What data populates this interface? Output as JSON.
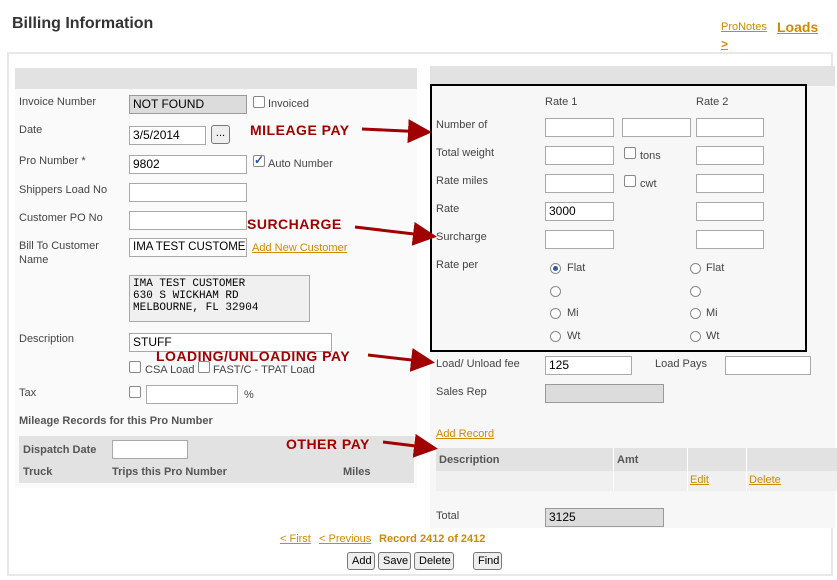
{
  "page": {
    "title": "Billing Information",
    "nav": {
      "pronotes": "ProNotes",
      "loads": "Loads",
      "arrow": ">"
    }
  },
  "left": {
    "invoice_number": {
      "label": "Invoice Number",
      "value": "NOT FOUND",
      "invoiced_label": "Invoiced"
    },
    "date": {
      "label": "Date",
      "value": "3/5/2014",
      "picker": "..."
    },
    "pro_number": {
      "label": "Pro Number *",
      "value": "9802",
      "auto_label": "Auto Number"
    },
    "shippers_load": {
      "label": "Shippers Load No",
      "value": ""
    },
    "customer_po": {
      "label": "Customer PO No",
      "value": ""
    },
    "bill_to": {
      "label_line1": "Bill To Customer",
      "label_line2": "Name",
      "value": "IMA TEST CUSTOMER",
      "add_link": "Add New Customer"
    },
    "address": {
      "line1": "IMA TEST CUSTOMER",
      "line2": "630 S WICKHAM RD",
      "line3": "MELBOURNE, FL 32904"
    },
    "description": {
      "label": "Description",
      "value": "STUFF"
    },
    "csa_label": "CSA Load",
    "fast_label": "FAST/C - TPAT Load",
    "tax": {
      "label": "Tax",
      "value": "",
      "unit": "%"
    },
    "mileage_title": "Mileage Records for this Pro Number",
    "mileage": {
      "dispatch_date_label": "Dispatch Date",
      "truck": "Truck",
      "trips": "Trips this Pro Number",
      "miles": "Miles"
    }
  },
  "right": {
    "rate1_header": "Rate 1",
    "rate2_header": "Rate 2",
    "number_of": "Number of",
    "total_weight": "Total weight",
    "tons": "tons",
    "rate_miles": "Rate miles",
    "cwt": "cwt",
    "rate": {
      "label": "Rate",
      "value": "3000"
    },
    "surcharge": "Surcharge",
    "rate_per": "Rate per",
    "flat": "Flat",
    "mi": "Mi",
    "wt": "Wt",
    "load_fee": {
      "label": "Load/ Unload fee",
      "value": "125",
      "pays_label": "Load Pays"
    },
    "sales_rep": "Sales Rep",
    "add_record": "Add Record",
    "table": {
      "description": "Description",
      "amt": "Amt",
      "edit": "Edit",
      "delete": "Delete"
    },
    "total": {
      "label": "Total",
      "value": "3125"
    }
  },
  "annotations": {
    "mileage_pay": "MILEAGE PAY",
    "surcharge": "SURCHARGE",
    "loading_pay": "LOADING/UNLOADING PAY",
    "other_pay": "OTHER PAY"
  },
  "footer": {
    "first": "< First",
    "previous": "< Previous",
    "record": "Record 2412 of 2412",
    "add": "Add",
    "save": "Save",
    "delete": "Delete",
    "find": "Find"
  },
  "colors": {
    "link": "#d08a00",
    "annotation": "#a00000",
    "panel_header": "#e2e2e2"
  }
}
